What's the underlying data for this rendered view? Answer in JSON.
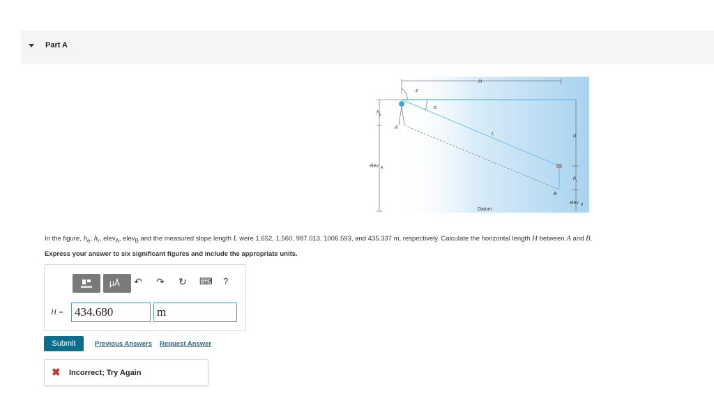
{
  "part": {
    "title": "Part A"
  },
  "figure": {
    "labels": {
      "H": "H",
      "z": "z",
      "alpha": "α",
      "he": "h",
      "he_sub": "e",
      "A": "A",
      "L": "L",
      "d": "d",
      "elevA": "elev",
      "elevA_sub": "A",
      "hr": "h",
      "hr_sub": "r",
      "B": "B",
      "elevB": "elev",
      "elevB_sub": "B",
      "datum": "Datum"
    }
  },
  "problem": {
    "intro": "In the figure, ",
    "he": "h",
    "he_sub": "e",
    "hr": "h",
    "hr_sub": "r",
    "elevA": "elev",
    "elevA_sub": "A",
    "elevB": "elev",
    "elevB_sub": "B",
    "mid": " and the measured slope length ",
    "L": "L",
    "values": " were 1.652, 1.560, 987.013, 1006.593, and 435.337 ",
    "unit_m": "m",
    "tail": ", respectively. Calculate the horizontal length ",
    "H": "H",
    "between": " between ",
    "A": "A",
    "and": " and ",
    "B": "B",
    "end": ".",
    "sep": ", ",
    "instruction": "Express your answer to six significant figures and include the appropriate units."
  },
  "answer": {
    "label": "H =",
    "value": "434.680",
    "unit": "m",
    "toolbar": {
      "templates_icon": "templates-icon",
      "units_icon": "units-icon",
      "units_label": "μÅ",
      "undo_icon": "undo-icon",
      "redo_icon": "redo-icon",
      "reset_icon": "reset-icon",
      "keyboard_icon": "keyboard-icon",
      "help_label": "?"
    }
  },
  "actions": {
    "submit": "Submit",
    "previous": "Previous Answers",
    "request": "Request Answer"
  },
  "feedback": {
    "icon": "x-mark-icon",
    "text": "Incorrect; Try Again",
    "color": "#c9302c"
  },
  "colors": {
    "submit": "#0a6e8c",
    "link": "#1a6d9c",
    "input_border": "#4d9bb8"
  }
}
